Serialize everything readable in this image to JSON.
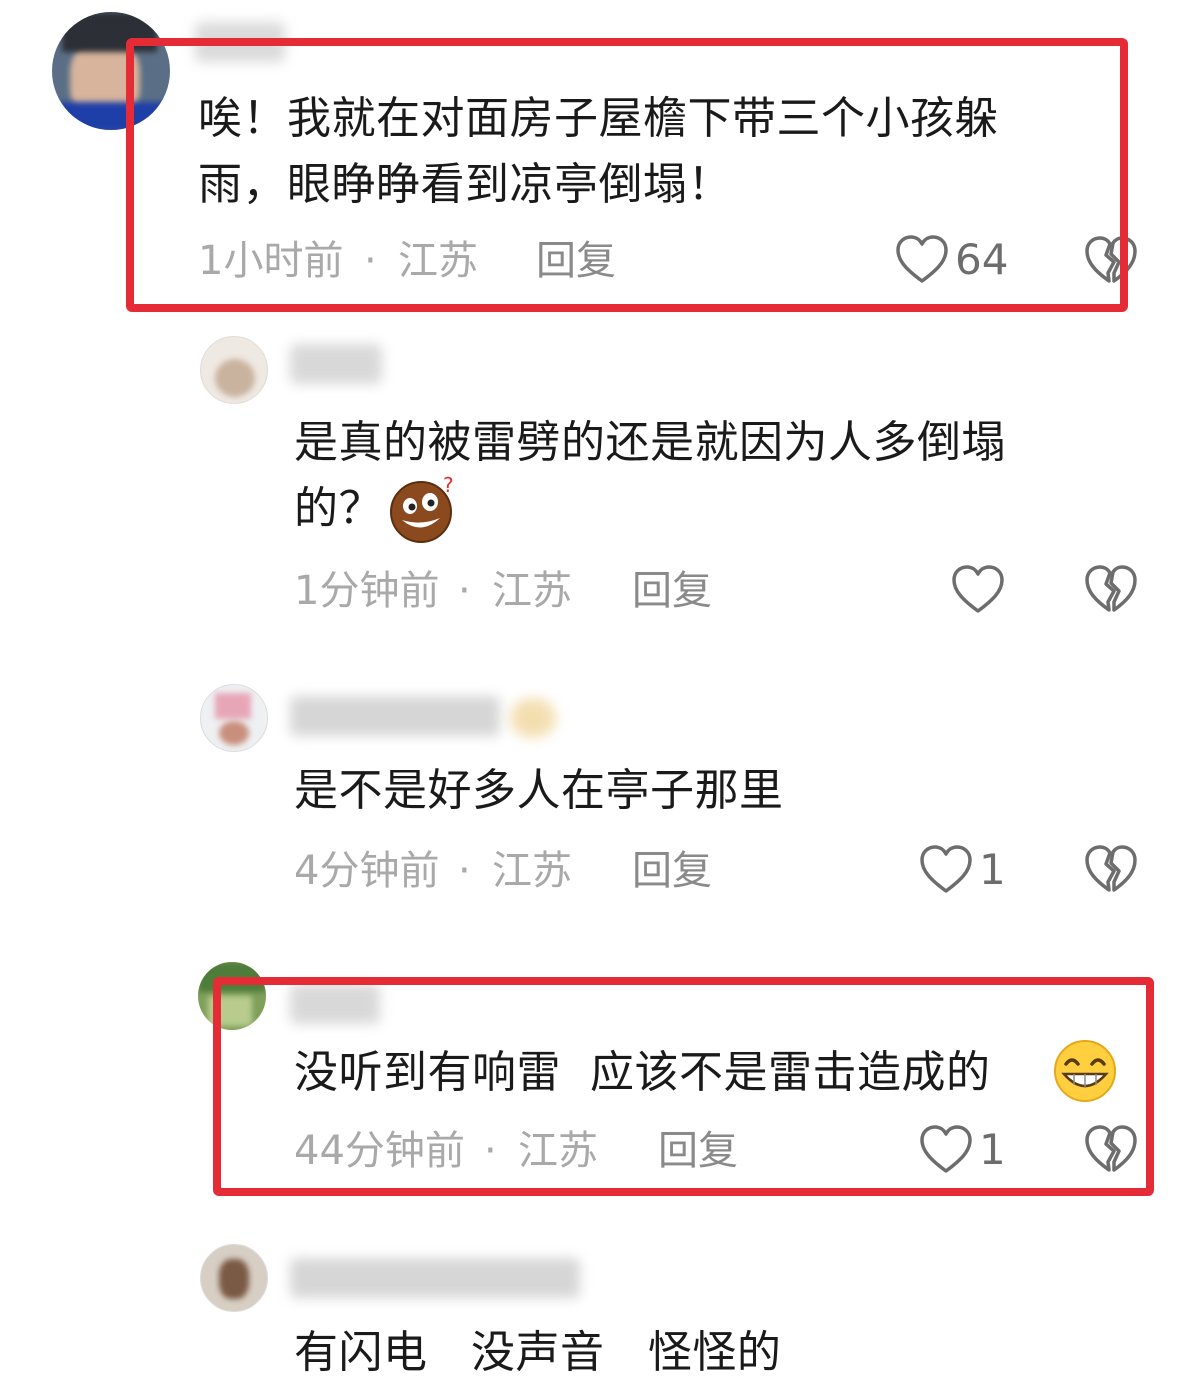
{
  "comments": [
    {
      "text_lines": [
        "唉！我就在对面房子屋檐下带三个小孩躲",
        "雨，眼睁睁看到凉亭倒塌！"
      ],
      "time": "1小时前",
      "location": "江苏",
      "reply_label": "回复",
      "like_count": "64",
      "highlighted": true
    },
    {
      "text_lines": [
        "是真的被雷劈的还是就因为人多倒塌",
        "的？"
      ],
      "emoji": "thinking-face-emoji",
      "time": "1分钟前",
      "location": "江苏",
      "reply_label": "回复",
      "like_count": ""
    },
    {
      "text_lines": [
        "是不是好多人在亭子那里"
      ],
      "time": "4分钟前",
      "location": "江苏",
      "reply_label": "回复",
      "like_count": "1"
    },
    {
      "text_lines": [
        "没听到有响雷  应该不是雷击造成的"
      ],
      "emoji": "grinning-face-emoji",
      "time": "44分钟前",
      "location": "江苏",
      "reply_label": "回复",
      "like_count": "1",
      "highlighted": true
    },
    {
      "text_lines": [
        "有闪电   没声音   怪怪的"
      ]
    }
  ],
  "meta_separator": "·",
  "colors": {
    "highlight": "#e52b35",
    "text": "#1a1a1a",
    "meta": "#a9a9a9",
    "icon": "#6d6d6d"
  },
  "icons": {
    "like": "heart-outline-icon",
    "dislike": "broken-heart-icon"
  }
}
